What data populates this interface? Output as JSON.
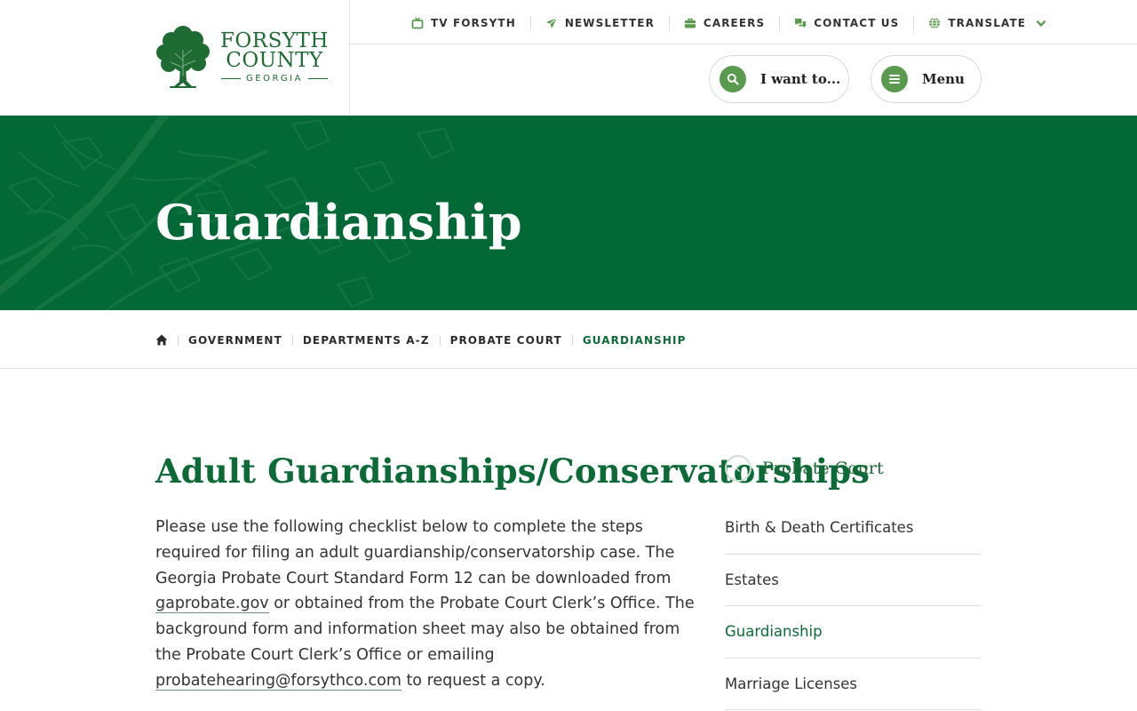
{
  "logo": {
    "line1": "FORSYTH",
    "line2": "COUNTY",
    "line3": "GEORGIA"
  },
  "utility_nav": [
    {
      "label": "TV FORSYTH",
      "icon": "tv-icon"
    },
    {
      "label": "NEWSLETTER",
      "icon": "paper-plane-icon"
    },
    {
      "label": "CAREERS",
      "icon": "briefcase-icon"
    },
    {
      "label": "CONTACT US",
      "icon": "chat-icon"
    },
    {
      "label": "TRANSLATE",
      "icon": "globe-icon"
    }
  ],
  "actions": {
    "want_label": "I want to...",
    "menu_label": "Menu"
  },
  "hero": {
    "title": "Guardianship"
  },
  "breadcrumb": [
    "GOVERNMENT",
    "DEPARTMENTS A-Z",
    "PROBATE COURT",
    "GUARDIANSHIP"
  ],
  "main": {
    "heading": "Adult Guardianships/Conservatorships",
    "paragraph": {
      "part1": "Please use the following checklist below to complete the steps required for filing an adult guardianship/conservatorship case. The Georgia Probate Court Standard Form 12 can be downloaded from ",
      "link1": "gaprobate.gov",
      "part2": " or obtained from the Probate Court Clerk’s Office. The background form and information sheet may also be obtained from the Probate Court Clerk’s Office or emailing ",
      "link2": "probatehearing@forsythco.com",
      "part3": " to request a copy."
    }
  },
  "sidebar": {
    "heading": "Probate Court",
    "items": [
      "Birth & Death Certificates",
      "Estates",
      "Guardianship",
      "Marriage Licenses"
    ],
    "active_index": 2
  },
  "colors": {
    "brand_green": "#016836",
    "accent_green": "#5a9a4e",
    "link_green": "#0b6a35"
  }
}
